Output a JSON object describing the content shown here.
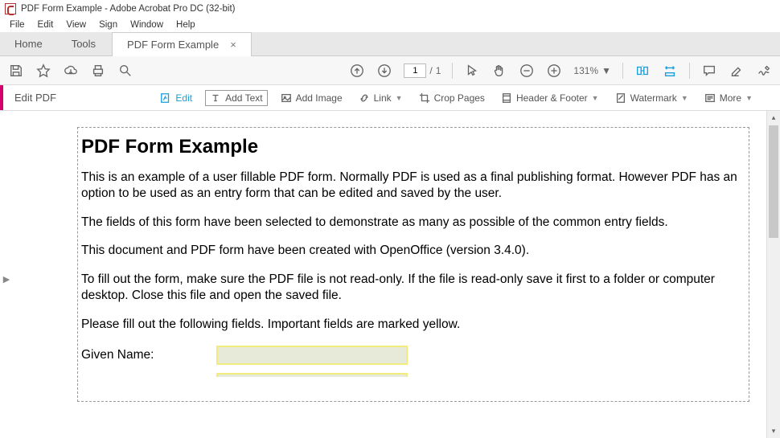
{
  "titlebar": {
    "title": "PDF Form Example - Adobe Acrobat Pro DC (32-bit)"
  },
  "menubar": {
    "items": [
      "File",
      "Edit",
      "View",
      "Sign",
      "Window",
      "Help"
    ]
  },
  "tabs": {
    "home": "Home",
    "tools": "Tools",
    "file": "PDF Form Example"
  },
  "toolbar": {
    "page_current": "1",
    "page_total": "1",
    "zoom": "131%"
  },
  "editbar": {
    "title": "Edit PDF",
    "tools": {
      "edit": "Edit",
      "add_text": "Add Text",
      "add_image": "Add Image",
      "link": "Link",
      "crop": "Crop Pages",
      "header_footer": "Header & Footer",
      "watermark": "Watermark",
      "more": "More"
    }
  },
  "document": {
    "heading": "PDF Form Example",
    "p1": "This is an example of a user fillable PDF form. Normally PDF is used as a final publishing format. However PDF has an option to be used as an entry form that can be edited and saved by the user.",
    "p2": "The fields of this form have been selected to demonstrate as many as possible of the common entry fields.",
    "p3": "This document and PDF form have been created with OpenOffice (version 3.4.0).",
    "p4": "To fill out the form, make sure the PDF file is not read-only. If the file is read-only save it first to a folder or computer desktop. Close this file and open the saved file.",
    "p5": "Please fill out the following fields. Important fields are marked yellow.",
    "given_name_label": "Given Name:"
  }
}
